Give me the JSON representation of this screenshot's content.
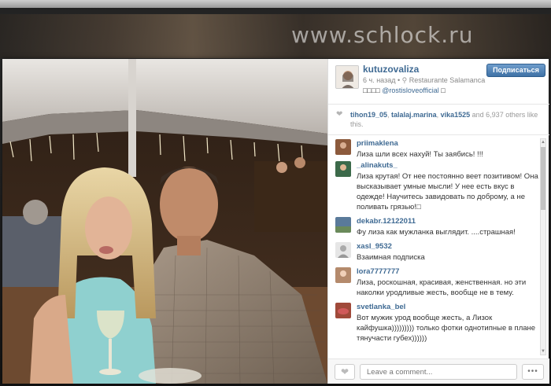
{
  "watermark": "www.schlock.ru",
  "post": {
    "username": "kutuzovaliza",
    "time_ago": "6 ч. назад",
    "location": "Restaurante Salamanca",
    "caption_prefix": "□□□□ ",
    "caption_mention": "@rostisloveofficial",
    "caption_suffix": " □",
    "follow_label": "Подписаться"
  },
  "likes": {
    "users": [
      "tihon19_05",
      "talalaj.marina",
      "vika1525"
    ],
    "suffix": "and 6,937 others like this."
  },
  "comments": [
    {
      "user": "priimaklena",
      "text": "Лиза шли всех нахуй! Ты заябись! !!!",
      "avatar_color": "#8c5a3c"
    },
    {
      "user": "_alinakuts_",
      "text": "Лиза крутая! От нее постоянно веет позитивом! Она высказывает умные мысли! У нее есть вкус в одежде! Научитесь завидовать по доброму, а не поливать грязью!□",
      "avatar_color": "#3c6a4a"
    },
    {
      "user": "dekabr.12122011",
      "text": "Фу лиза как мужланка выглядит. ....страшная!",
      "avatar_color": "#5a7a9a"
    },
    {
      "user": "xasl_9532",
      "text": "Взаимная подписка",
      "avatar_color": "#d6d6d6"
    },
    {
      "user": "lora7777777",
      "text": "Лиза, роскошная, красивая, женственная. но эти наколки уродливые жесть, вообще не в тему.",
      "avatar_color": "#b48a6c"
    },
    {
      "user": "svetlanka_bel",
      "text": "Вот мужик урод вообще жесть, а Лизок кайфушка))))))))) только фотки однотипные в плане тянучасти губех))))))",
      "avatar_color": "#a04a3a"
    }
  ],
  "comment_input_placeholder": "Leave a comment...",
  "more_label": "•••"
}
